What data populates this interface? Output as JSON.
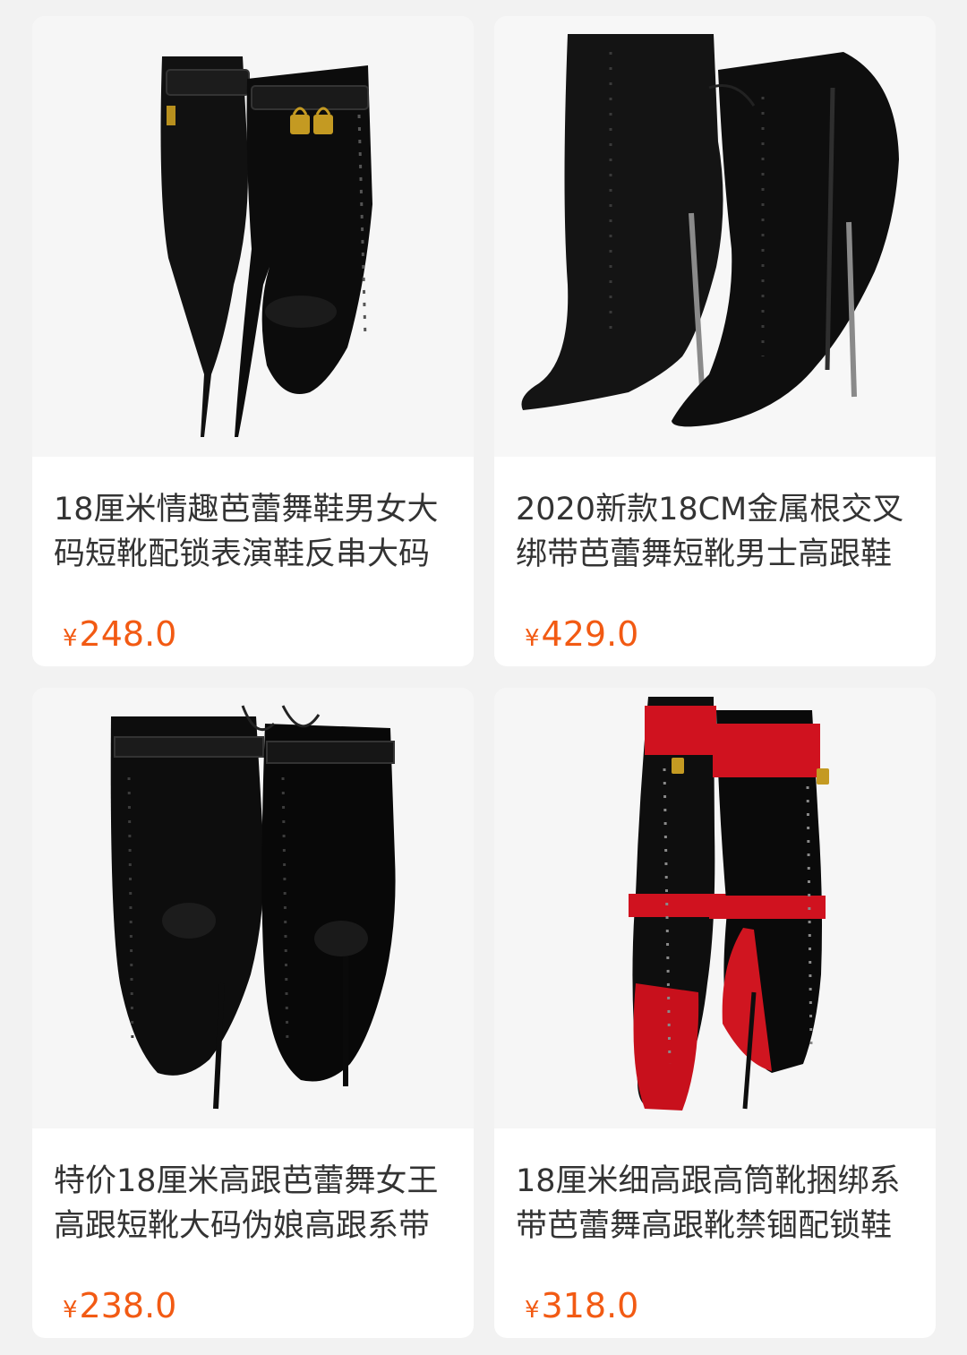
{
  "products": [
    {
      "title": "18厘米情趣芭蕾舞鞋男女大码短靴配锁表演鞋反串大码",
      "currency": "¥",
      "price": "248.0",
      "image": "black-patent-ballet-ankle-boots-with-padlocks"
    },
    {
      "title": "2020新款18CM金属根交叉绑带芭蕾舞短靴男士高跟鞋",
      "currency": "¥",
      "price": "429.0",
      "image": "black-leather-lace-up-stiletto-ankle-boots"
    },
    {
      "title": "特价18厘米高跟芭蕾舞女王高跟短靴大码伪娘高跟系带",
      "currency": "¥",
      "price": "238.0",
      "image": "black-patent-lace-up-ballet-ankle-boots"
    },
    {
      "title": "18厘米细高跟高筒靴捆绑系带芭蕾舞高跟靴禁锢配锁鞋",
      "currency": "¥",
      "price": "318.0",
      "image": "red-black-knee-high-ballet-boots-with-locks"
    }
  ],
  "colors": {
    "background": "#f2f2f2",
    "card": "#ffffff",
    "price": "#f25a13",
    "title": "#333333"
  }
}
